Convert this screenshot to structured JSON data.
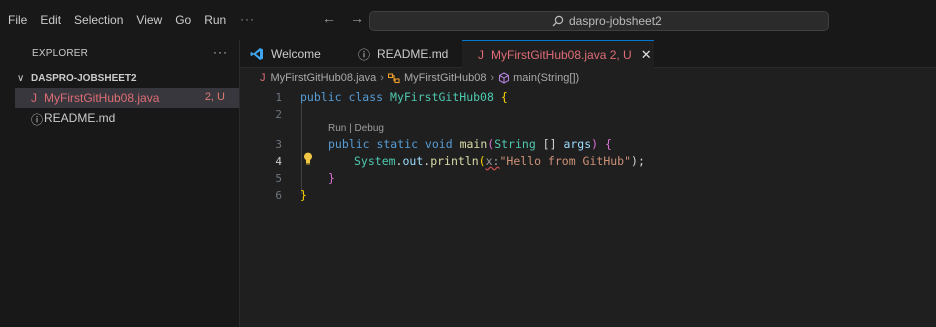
{
  "menu": {
    "items": [
      "File",
      "Edit",
      "Selection",
      "View",
      "Go",
      "Run"
    ],
    "more": "···"
  },
  "nav": {
    "back": "←",
    "forward": "→"
  },
  "search": {
    "text": "daspro-jobsheet2",
    "icon": "search-icon"
  },
  "explorer": {
    "header": "EXPLORER",
    "more": "···",
    "folder": {
      "chevron": "∨",
      "name": "DASPRO-JOBSHEET2"
    },
    "files": [
      {
        "icon": "J",
        "name": "MyFirstGitHub08.java",
        "badge": "2, U"
      },
      {
        "icon": "ⓘ",
        "name": "README.md",
        "badge": ""
      }
    ]
  },
  "tabs": [
    {
      "icon": "vscode-icon",
      "label": "Welcome"
    },
    {
      "icon": "ⓘ",
      "label": "README.md"
    },
    {
      "icon": "J",
      "label": "MyFirstGitHub08.java 2, U",
      "close": "✕"
    }
  ],
  "breadcrumb": {
    "file_icon": "J",
    "file": "MyFirstGitHub08.java",
    "sep": "›",
    "class_icon": "class-icon",
    "class_name": "MyFirstGitHub08",
    "method_icon": "method-icon",
    "method": "main(String[])"
  },
  "editor": {
    "line_numbers": [
      "1",
      "2",
      "3",
      "4",
      "5",
      "6"
    ],
    "codelens": "Run | Debug",
    "code": {
      "l1_kw": "public class",
      "l1_cls": "MyFirstGitHub08",
      "l1_brace": "{",
      "l3_kw": "public static void",
      "l3_fn": "main",
      "l3_open": "(",
      "l3_type": "String",
      "l3_arr": " [] ",
      "l3_param": "args",
      "l3_close": ")",
      "l3_brace": "{",
      "l4_cls": "System",
      "l4_dot1": ".",
      "l4_field": "out",
      "l4_dot2": ".",
      "l4_fn": "println",
      "l4_open": "(",
      "l4_hint": "x:",
      "l4_str": "\"Hello from GitHub\"",
      "l4_end": ");",
      "l5_brace": "}",
      "l6_brace": "}"
    }
  },
  "colors": {
    "accent": "#0078d4",
    "java_icon": "#e06c75",
    "badge": "#e07b73"
  }
}
